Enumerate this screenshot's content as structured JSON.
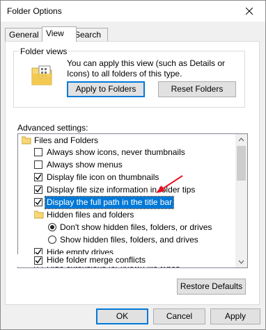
{
  "window": {
    "title": "Folder Options"
  },
  "tabs": [
    {
      "label": "General",
      "active": false
    },
    {
      "label": "View",
      "active": true
    },
    {
      "label": "Search",
      "active": false
    }
  ],
  "folder_views": {
    "group_label": "Folder views",
    "description": "You can apply this view (such as Details or Icons) to all folders of this type.",
    "apply_label": "Apply to Folders",
    "reset_label": "Reset Folders"
  },
  "advanced": {
    "label": "Advanced settings:",
    "items": [
      {
        "type": "folder",
        "label": "Files and Folders"
      },
      {
        "type": "checkbox",
        "checked": false,
        "label": "Always show icons, never thumbnails"
      },
      {
        "type": "checkbox",
        "checked": false,
        "label": "Always show menus"
      },
      {
        "type": "checkbox",
        "checked": true,
        "label": "Display file icon on thumbnails"
      },
      {
        "type": "checkbox",
        "checked": true,
        "label": "Display file size information in folder tips"
      },
      {
        "type": "checkbox",
        "checked": true,
        "label": "Display the full path in the title bar",
        "selected": true
      },
      {
        "type": "folder",
        "label": "Hidden files and folders"
      },
      {
        "type": "radio",
        "checked": true,
        "label": "Don't show hidden files, folders, or drives"
      },
      {
        "type": "radio",
        "checked": false,
        "label": "Show hidden files, folders, and drives"
      },
      {
        "type": "checkbox",
        "checked": true,
        "label": "Hide empty drives"
      },
      {
        "type": "checkbox",
        "checked": true,
        "label": "Hide extensions for known file types"
      },
      {
        "type": "checkbox",
        "checked": true,
        "label": "Hide folder merge conflicts"
      }
    ]
  },
  "buttons": {
    "restore_defaults": "Restore Defaults",
    "ok": "OK",
    "cancel": "Cancel",
    "apply": "Apply"
  },
  "colors": {
    "selection": "#0078d7",
    "annotation_arrow": "#e81123",
    "folder": "#f8d775"
  },
  "icons": {
    "close": "close-icon",
    "folder": "folder-icon",
    "annotation": "red-arrow-annotation"
  }
}
